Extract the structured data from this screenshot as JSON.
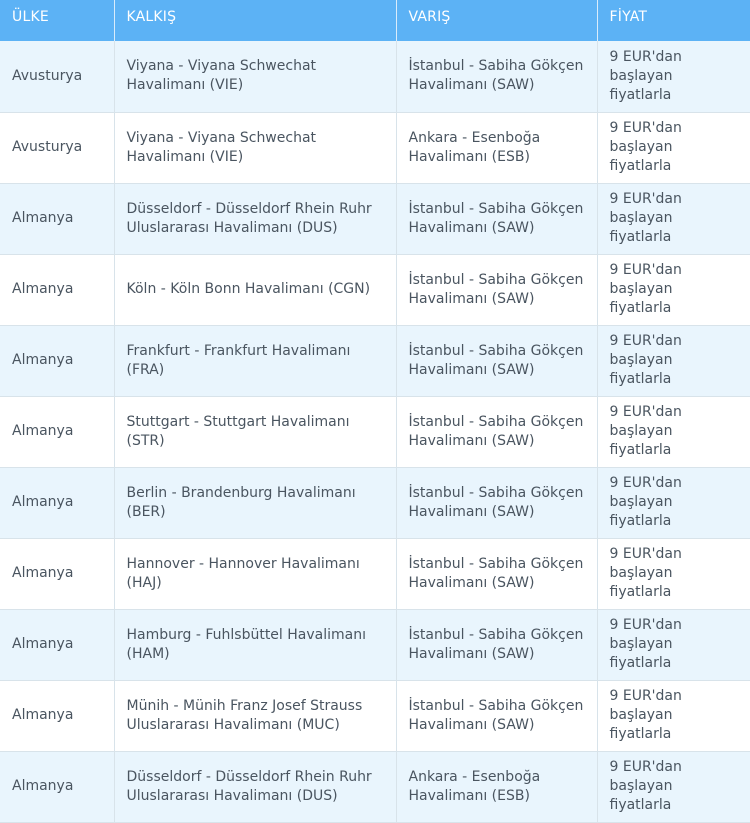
{
  "headers": [
    "ÜLKE",
    "KALKIŞ",
    "VARIŞ",
    "FİYAT"
  ],
  "rows": [
    {
      "country": "Avusturya",
      "from": "Viyana - Viyana Schwechat Havalimanı (VIE)",
      "to": "İstanbul - Sabiha Gökçen Havalimanı (SAW)",
      "price": "9 EUR'dan başlayan fiyatlarla"
    },
    {
      "country": "Avusturya",
      "from": "Viyana - Viyana Schwechat Havalimanı (VIE)",
      "to": "Ankara - Esenboğa Havalimanı (ESB)",
      "price": "9 EUR'dan başlayan fiyatlarla"
    },
    {
      "country": "Almanya",
      "from": "Düsseldorf - Düsseldorf Rhein Ruhr Uluslararası Havalimanı (DUS)",
      "to": "İstanbul - Sabiha Gökçen Havalimanı (SAW)",
      "price": "9 EUR'dan başlayan fiyatlarla"
    },
    {
      "country": "Almanya",
      "from": "Köln - Köln Bonn Havalimanı (CGN)",
      "to": "İstanbul - Sabiha Gökçen Havalimanı (SAW)",
      "price": "9 EUR'dan başlayan fiyatlarla"
    },
    {
      "country": "Almanya",
      "from": "Frankfurt - Frankfurt Havalimanı (FRA)",
      "to": "İstanbul - Sabiha Gökçen Havalimanı (SAW)",
      "price": "9 EUR'dan başlayan fiyatlarla"
    },
    {
      "country": "Almanya",
      "from": "Stuttgart - Stuttgart Havalimanı (STR)",
      "to": "İstanbul - Sabiha Gökçen Havalimanı (SAW)",
      "price": "9 EUR'dan başlayan fiyatlarla"
    },
    {
      "country": "Almanya",
      "from": "Berlin - Brandenburg Havalimanı (BER)",
      "to": "İstanbul - Sabiha Gökçen Havalimanı (SAW)",
      "price": "9 EUR'dan başlayan fiyatlarla"
    },
    {
      "country": "Almanya",
      "from": "Hannover - Hannover Havalimanı (HAJ)",
      "to": "İstanbul - Sabiha Gökçen Havalimanı (SAW)",
      "price": "9 EUR'dan başlayan fiyatlarla"
    },
    {
      "country": "Almanya",
      "from": "Hamburg - Fuhlsbüttel Havalimanı (HAM)",
      "to": "İstanbul - Sabiha Gökçen Havalimanı (SAW)",
      "price": "9 EUR'dan başlayan fiyatlarla"
    },
    {
      "country": "Almanya",
      "from": "Münih - Münih Franz Josef Strauss Uluslararası Havalimanı (MUC)",
      "to": "İstanbul - Sabiha Gökçen Havalimanı (SAW)",
      "price": "9 EUR'dan başlayan fiyatlarla"
    },
    {
      "country": "Almanya",
      "from": "Düsseldorf - Düsseldorf Rhein Ruhr Uluslararası Havalimanı (DUS)",
      "to": "Ankara - Esenboğa Havalimanı (ESB)",
      "price": "9 EUR'dan başlayan fiyatlarla"
    }
  ]
}
